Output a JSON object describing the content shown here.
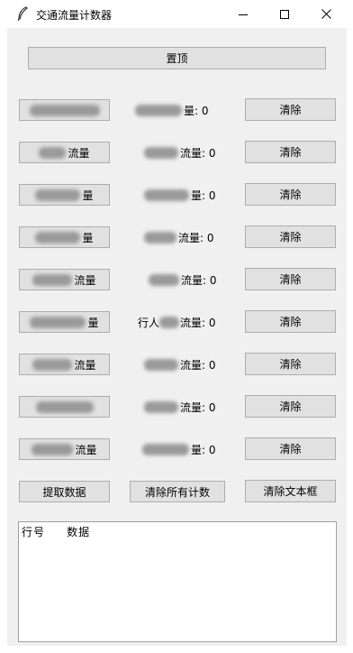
{
  "window": {
    "title": "交通流量计数器",
    "icon": "feather-icon",
    "controls": [
      "minimize-icon",
      "maximize-icon",
      "close-icon"
    ]
  },
  "top_button": "置顶",
  "rows": [
    {
      "label_value": "量: 0",
      "clear_label": "清除"
    },
    {
      "button_visible": "流量",
      "label_value": "流量: 0",
      "clear_label": "清除"
    },
    {
      "button_visible": "量",
      "label_value": "量: 0",
      "clear_label": "清除"
    },
    {
      "button_visible": "量",
      "label_value": "流量: 0",
      "clear_label": "清除"
    },
    {
      "button_visible": "流量",
      "label_value": "流量: 0",
      "clear_label": "清除"
    },
    {
      "button_visible": "量",
      "label_visible": "行人",
      "label_value": "流量: 0",
      "clear_label": "清除"
    },
    {
      "button_visible": "流量",
      "label_value": "流量: 0",
      "clear_label": "清除"
    },
    {
      "label_value": "流量: 0",
      "clear_label": "清除"
    },
    {
      "button_visible": "流量",
      "label_value": "量: 0",
      "clear_label": "清除"
    }
  ],
  "actions": {
    "extract": "提取数据",
    "clear_all": "清除所有计数",
    "clear_text": "清除文本框"
  },
  "textbox": {
    "col_row": "行号",
    "col_data": "数据"
  }
}
